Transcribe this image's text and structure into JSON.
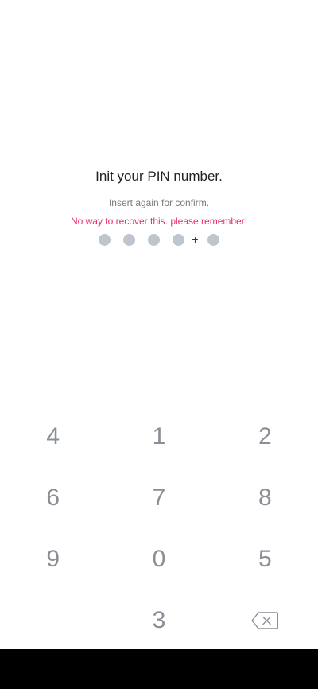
{
  "header": {
    "title": "Init your PIN number.",
    "subtitle": "Insert again for confirm.",
    "warning": "No way to recover this. please remember!"
  },
  "pin_indicator": {
    "dots_before_plus": 4,
    "separator": "+",
    "dots_after_plus": 1,
    "dot_color": "#bfc5cd"
  },
  "keypad": {
    "rows": [
      [
        "4",
        "1",
        "2"
      ],
      [
        "6",
        "7",
        "8"
      ],
      [
        "9",
        "0",
        "5"
      ],
      [
        "",
        "3",
        "backspace"
      ]
    ],
    "key_color": "#8a8f95"
  },
  "colors": {
    "warning": "#e62e6b",
    "background": "#ffffff",
    "nav_bar": "#000000"
  }
}
